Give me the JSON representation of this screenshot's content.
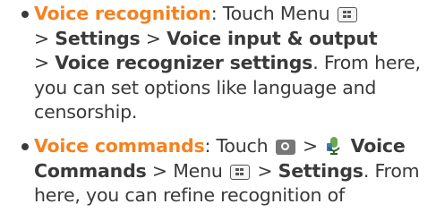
{
  "items": [
    {
      "term": "Voice recognition",
      "sep": ": ",
      "t1": "Touch Menu",
      "gt1": " > ",
      "b1": "Settings",
      "gt2": " > ",
      "b2": "Voice input & output",
      "gt3": " > ",
      "b3": "Voice recognizer settings",
      "tail": ". From here, you can set options like language and censorship."
    },
    {
      "term": "Voice commands",
      "sep": ": ",
      "t1": "Touch",
      "gt1": " > ",
      "b1": "Voice Commands",
      "gt2": " > ",
      "t2": "Menu",
      "gt3": " > ",
      "b2": "Settings",
      "tail": ". From here, you can refine recognition of"
    }
  ],
  "icons": {
    "menu": "menu-key-icon",
    "search": "search-key-icon",
    "voice_app": "voice-commands-app-icon"
  },
  "colors": {
    "accent": "#f58220",
    "text": "#3a3a3a"
  }
}
